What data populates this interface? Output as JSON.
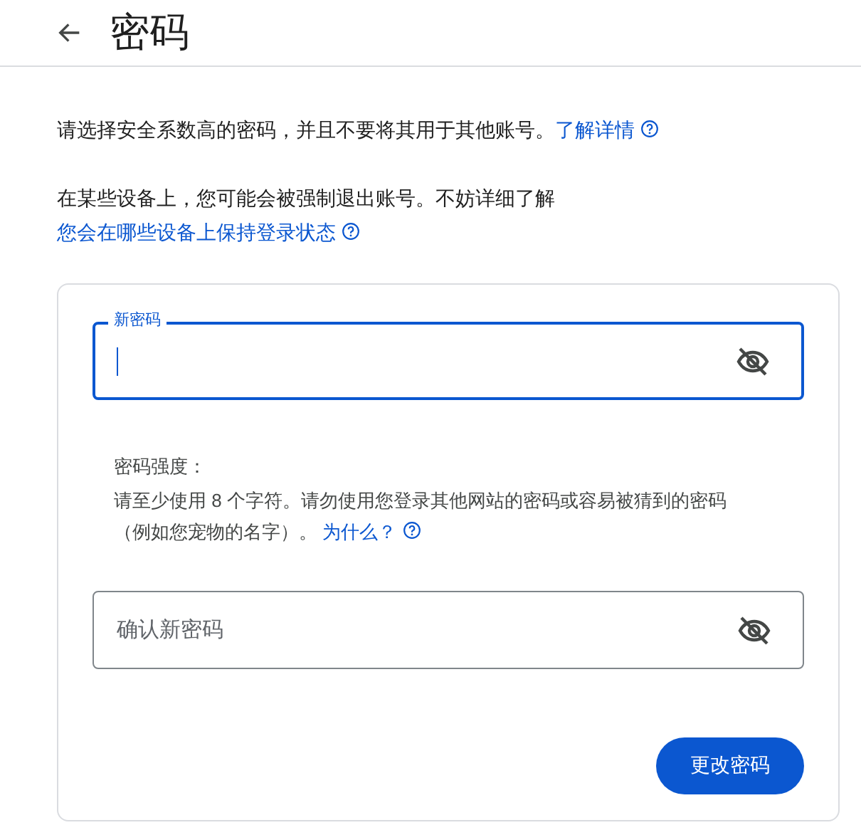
{
  "header": {
    "title": "密码"
  },
  "intro": [
    {
      "text": "请选择安全系数高的密码，并且不要将其用于其他账号。",
      "link": "了解详情"
    },
    {
      "text": "在某些设备上，您可能会被强制退出账号。不妨详细了解",
      "link": "您会在哪些设备上保持登录状态"
    }
  ],
  "fields": [
    {
      "label": "新密码",
      "focused": true
    },
    {
      "placeholder": "确认新密码",
      "focused": false
    }
  ],
  "strength": {
    "label": "密码强度：",
    "hint": "请至少使用 8 个字符。请勿使用您登录其他网站的密码或容易被猜到的密码（例如您宠物的名字）。",
    "link": "为什么？"
  },
  "submit_button": "更改密码"
}
